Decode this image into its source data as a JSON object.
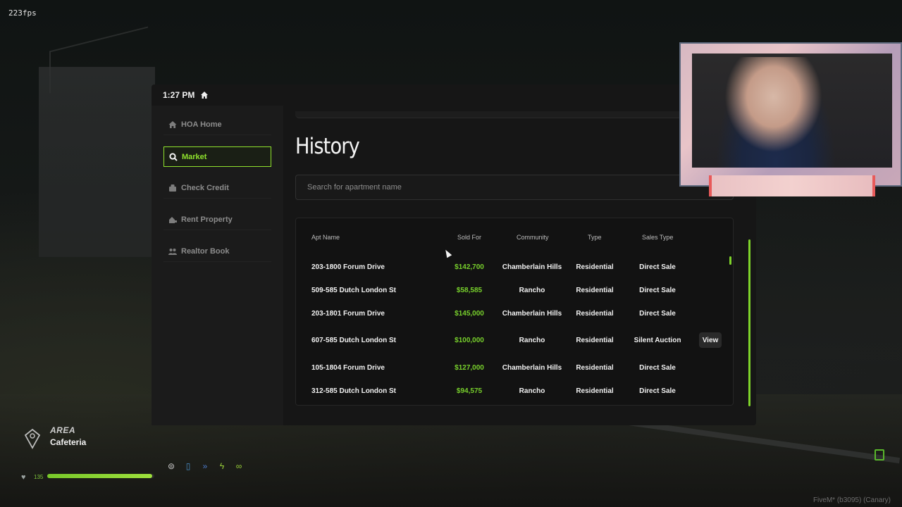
{
  "fps": "223fps",
  "status_bar": {
    "time": "1:27 PM"
  },
  "sidebar": {
    "items": [
      {
        "label": "HOA Home",
        "icon": "home-icon",
        "active": false
      },
      {
        "label": "Market",
        "icon": "search-icon",
        "active": true
      },
      {
        "label": "Check Credit",
        "icon": "credit-icon",
        "active": false
      },
      {
        "label": "Rent Property",
        "icon": "property-icon",
        "active": false
      },
      {
        "label": "Realtor Book",
        "icon": "users-icon",
        "active": false
      }
    ]
  },
  "main": {
    "title": "History",
    "search": {
      "placeholder": "Search for apartment name",
      "value": ""
    },
    "table": {
      "columns": [
        "Apt Name",
        "Sold For",
        "Community",
        "Type",
        "Sales Type"
      ],
      "rows": [
        {
          "apt_name": "203-1800 Forum Drive",
          "sold_for": "$142,700",
          "community": "Chamberlain Hills",
          "type": "Residential",
          "sales_type": "Direct Sale",
          "action": ""
        },
        {
          "apt_name": "509-585 Dutch London St",
          "sold_for": "$58,585",
          "community": "Rancho",
          "type": "Residential",
          "sales_type": "Direct Sale",
          "action": ""
        },
        {
          "apt_name": "203-1801 Forum Drive",
          "sold_for": "$145,000",
          "community": "Chamberlain Hills",
          "type": "Residential",
          "sales_type": "Direct Sale",
          "action": ""
        },
        {
          "apt_name": "607-585 Dutch London St",
          "sold_for": "$100,000",
          "community": "Rancho",
          "type": "Residential",
          "sales_type": "Silent Auction",
          "action": "View"
        },
        {
          "apt_name": "105-1804 Forum Drive",
          "sold_for": "$127,000",
          "community": "Chamberlain Hills",
          "type": "Residential",
          "sales_type": "Direct Sale",
          "action": ""
        },
        {
          "apt_name": "312-585 Dutch London St",
          "sold_for": "$94,575",
          "community": "Rancho",
          "type": "Residential",
          "sales_type": "Direct Sale",
          "action": ""
        }
      ]
    }
  },
  "hud": {
    "area_label": "AREA",
    "area_value": "Cafeteria",
    "health_value": "135",
    "health_fraction": 0.98
  },
  "footer": {
    "version": "FiveM* (b3095) (Canary)"
  },
  "colors": {
    "accent": "#8fe22d",
    "price": "#78d12c",
    "panel": "#161616"
  }
}
